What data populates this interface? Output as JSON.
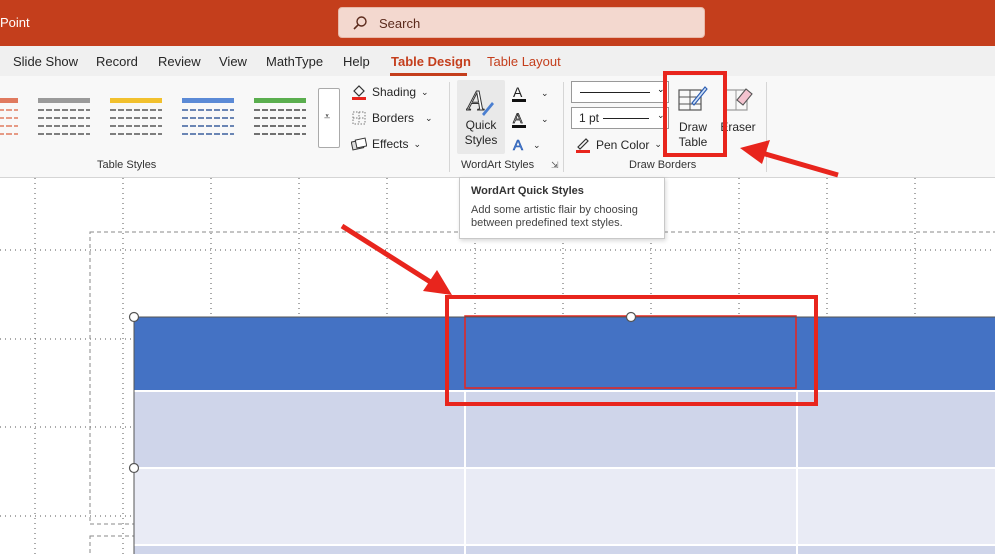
{
  "app": {
    "name": "Point"
  },
  "search": {
    "placeholder": "Search"
  },
  "tabs": [
    {
      "label": "Slide Show"
    },
    {
      "label": "Record"
    },
    {
      "label": "Review"
    },
    {
      "label": "View"
    },
    {
      "label": "MathType"
    },
    {
      "label": "Help"
    },
    {
      "label": "Table Design",
      "active": true
    },
    {
      "label": "Table Layout"
    }
  ],
  "ribbon": {
    "table_styles": {
      "label": "Table Styles",
      "more_icon": "gallery-more-icon"
    },
    "shading": {
      "label": "Shading"
    },
    "borders": {
      "label": "Borders"
    },
    "effects": {
      "label": "Effects"
    },
    "wordart": {
      "label": "WordArt Styles",
      "quick_styles_line1": "Quick",
      "quick_styles_line2": "Styles"
    },
    "draw_borders": {
      "label": "Draw Borders",
      "pen_weight": "1 pt",
      "pen_color": "Pen Color",
      "draw_table_line1": "Draw",
      "draw_table_line2": "Table",
      "eraser": "Eraser"
    }
  },
  "tooltip": {
    "title": "WordArt Quick Styles",
    "body": "Add some artistic flair by choosing between predefined text styles."
  },
  "colors": {
    "titlebar": "#c43e1c",
    "accent": "#c43e1c",
    "table_header": "#4472c4",
    "table_row_dark": "#cfd5ea",
    "table_row_light": "#e9ebf5",
    "annotation": "#e8251d"
  }
}
